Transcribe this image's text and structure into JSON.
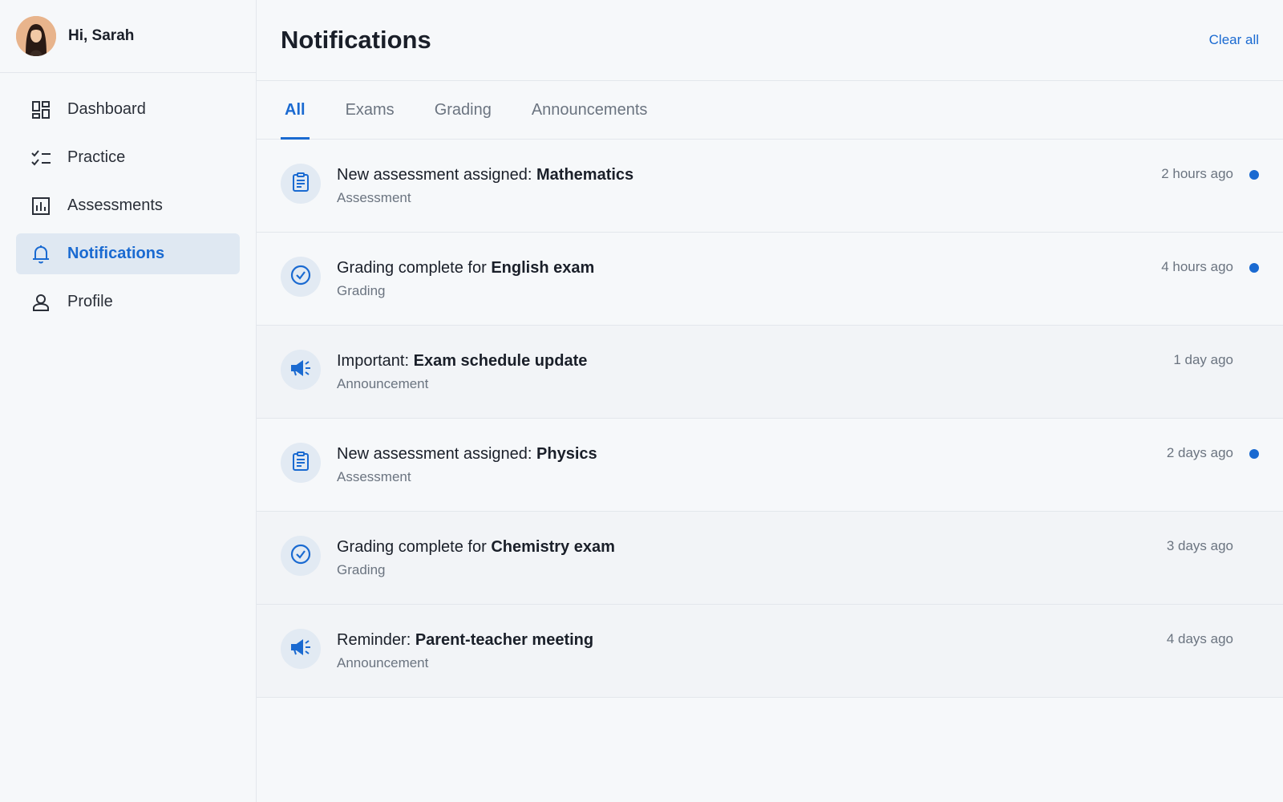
{
  "user": {
    "greeting": "Hi, Sarah"
  },
  "nav": [
    {
      "label": "Dashboard",
      "icon": "dashboard-icon",
      "active": false
    },
    {
      "label": "Practice",
      "icon": "checklist-icon",
      "active": false
    },
    {
      "label": "Assessments",
      "icon": "bar-chart-icon",
      "active": false
    },
    {
      "label": "Notifications",
      "icon": "bell-icon",
      "active": true
    },
    {
      "label": "Profile",
      "icon": "person-icon",
      "active": false
    }
  ],
  "header": {
    "title": "Notifications",
    "clear_label": "Clear all"
  },
  "tabs": [
    {
      "label": "All",
      "active": true
    },
    {
      "label": "Exams",
      "active": false
    },
    {
      "label": "Grading",
      "active": false
    },
    {
      "label": "Announcements",
      "active": false
    }
  ],
  "notifications": [
    {
      "prefix": "New assessment assigned: ",
      "subject": "Mathematics",
      "category": "Assessment",
      "time": "2 hours ago",
      "unread": true,
      "icon": "clipboard-icon"
    },
    {
      "prefix": "Grading complete for ",
      "subject": "English exam",
      "category": "Grading",
      "time": "4 hours ago",
      "unread": true,
      "icon": "check-circle-icon"
    },
    {
      "prefix": "Important: ",
      "subject": "Exam schedule update",
      "category": "Announcement",
      "time": "1 day ago",
      "unread": false,
      "icon": "megaphone-icon"
    },
    {
      "prefix": "New assessment assigned: ",
      "subject": "Physics",
      "category": "Assessment",
      "time": "2 days ago",
      "unread": true,
      "icon": "clipboard-icon"
    },
    {
      "prefix": "Grading complete for ",
      "subject": "Chemistry exam",
      "category": "Grading",
      "time": "3 days ago",
      "unread": false,
      "icon": "check-circle-icon"
    },
    {
      "prefix": "Reminder: ",
      "subject": "Parent-teacher meeting",
      "category": "Announcement",
      "time": "4 days ago",
      "unread": false,
      "icon": "megaphone-icon"
    }
  ],
  "colors": {
    "accent": "#1a6ad1",
    "active_nav_bg": "#dfe8f2",
    "icon_circle_bg": "#e2eaf3"
  }
}
